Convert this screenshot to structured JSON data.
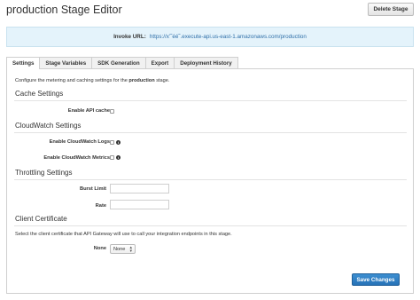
{
  "header": {
    "title": "production Stage Editor",
    "delete_label": "Delete Stage"
  },
  "invoke": {
    "label": "Invoke URL:",
    "url": "https://x’˜éé˜.execute-api.us-east-1.amazonaws.com/production"
  },
  "tabs": [
    {
      "label": "Settings",
      "active": true
    },
    {
      "label": "Stage Variables",
      "active": false
    },
    {
      "label": "SDK Generation",
      "active": false
    },
    {
      "label": "Export",
      "active": false
    },
    {
      "label": "Deployment History",
      "active": false
    }
  ],
  "settings": {
    "intro_prefix": "Configure the metering and caching settings for the ",
    "intro_stage": "production",
    "intro_suffix": " stage.",
    "cache": {
      "title": "Cache Settings",
      "enable_label": "Enable API cache",
      "enabled": false
    },
    "cloudwatch": {
      "title": "CloudWatch Settings",
      "logs_label": "Enable CloudWatch Logs",
      "metrics_label": "Enable CloudWatch Metrics",
      "logs_enabled": false,
      "metrics_enabled": false
    },
    "throttling": {
      "title": "Throttling Settings",
      "burst_label": "Burst Limit",
      "burst_value": "",
      "rate_label": "Rate",
      "rate_value": ""
    },
    "client_cert": {
      "title": "Client Certificate",
      "description": "Select the client certificate that API Gateway will use to call your integration endpoints in this stage.",
      "select_label": "None",
      "selected": "None"
    },
    "save_label": "Save Changes"
  },
  "colors": {
    "accent": "#2a78bd",
    "invoke_bg": "#e4f3fb"
  }
}
